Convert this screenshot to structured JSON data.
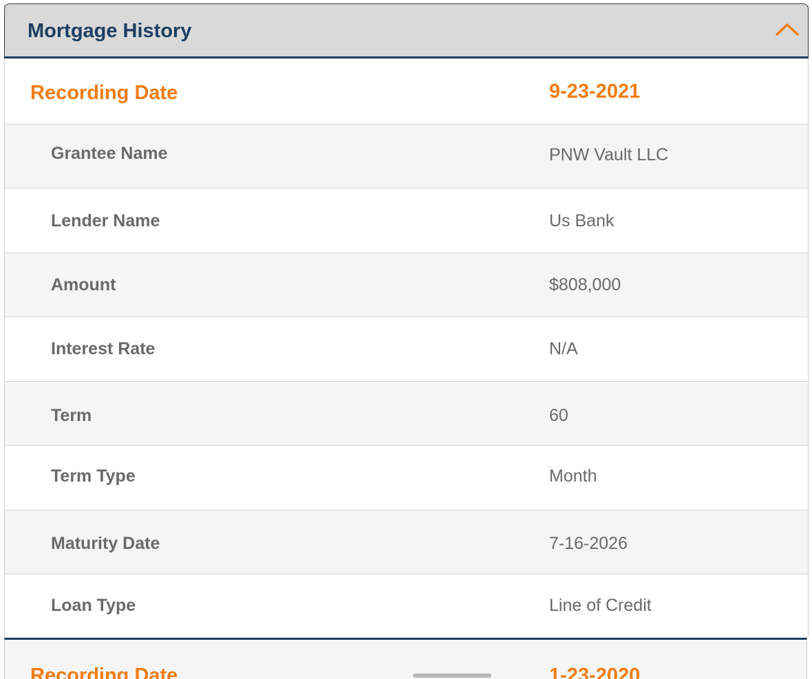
{
  "header": {
    "title": "Mortgage History",
    "collapse_icon": "chevron-up-icon",
    "accent_color": "#f07d12",
    "title_color": "#1c3f63"
  },
  "records": [
    {
      "recording_label": "Recording Date",
      "recording_date": "9-23-2021",
      "fields": [
        {
          "label": "Grantee Name",
          "value": "PNW Vault LLC"
        },
        {
          "label": "Lender Name",
          "value": "Us Bank"
        },
        {
          "label": "Amount",
          "value": "$808,000"
        },
        {
          "label": "Interest Rate",
          "value": "N/A"
        },
        {
          "label": "Term",
          "value": "60"
        },
        {
          "label": "Term Type",
          "value": "Month"
        },
        {
          "label": "Maturity Date",
          "value": "7-16-2026"
        },
        {
          "label": "Loan Type",
          "value": "Line of Credit"
        }
      ]
    },
    {
      "recording_label": "Recording Date",
      "recording_date": "1-23-2020"
    }
  ]
}
